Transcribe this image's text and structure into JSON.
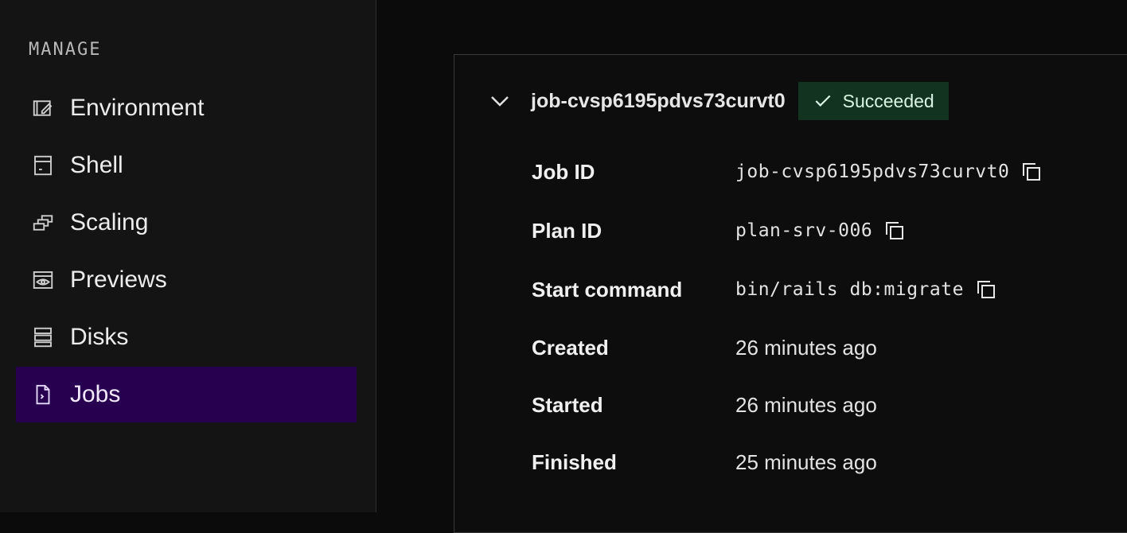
{
  "sidebar": {
    "section_label": "MANAGE",
    "items": [
      {
        "label": "Environment",
        "icon": "environment-edit-icon"
      },
      {
        "label": "Shell",
        "icon": "shell-terminal-icon"
      },
      {
        "label": "Scaling",
        "icon": "scaling-stack-icon"
      },
      {
        "label": "Previews",
        "icon": "preview-eye-icon"
      },
      {
        "label": "Disks",
        "icon": "disks-stack-icon"
      },
      {
        "label": "Jobs",
        "icon": "job-file-icon",
        "active": true
      }
    ]
  },
  "job": {
    "name": "job-cvsp6195pdvs73curvt0",
    "status": "Succeeded",
    "fields": [
      {
        "label": "Job ID",
        "value": "job-cvsp6195pdvs73curvt0",
        "copyable": true
      },
      {
        "label": "Plan ID",
        "value": "plan-srv-006",
        "copyable": true
      },
      {
        "label": "Start command",
        "value": "bin/rails db:migrate",
        "copyable": true
      },
      {
        "label": "Created",
        "value": "26 minutes ago"
      },
      {
        "label": "Started",
        "value": "26 minutes ago"
      },
      {
        "label": "Finished",
        "value": "25 minutes ago"
      }
    ]
  },
  "colors": {
    "active_nav_bg": "#270050",
    "badge_bg": "#11331f",
    "badge_text": "#d9f5e0"
  }
}
